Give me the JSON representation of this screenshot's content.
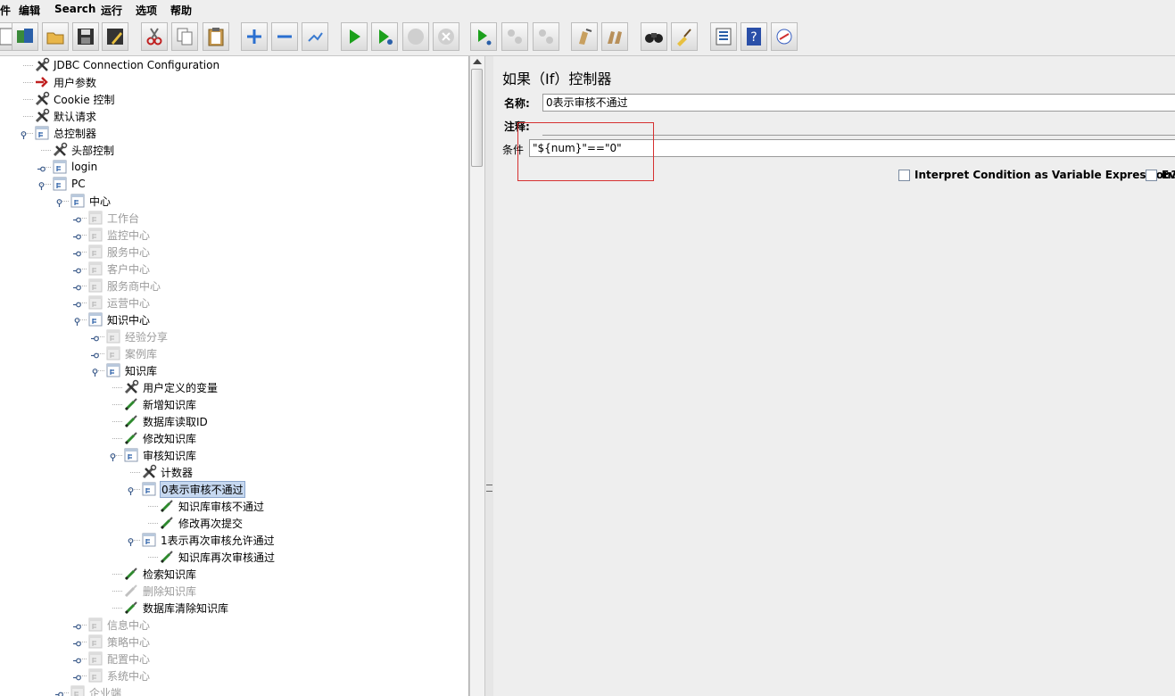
{
  "menu": [
    {
      "id": "file",
      "label": "件"
    },
    {
      "id": "edit",
      "label": "编辑"
    },
    {
      "id": "search",
      "label": "Search"
    },
    {
      "id": "run",
      "label": "运行"
    },
    {
      "id": "options",
      "label": "选项"
    },
    {
      "id": "help",
      "label": "帮助"
    }
  ],
  "toolbar": [
    "new-icon",
    "templates-icon",
    "open-icon",
    "save-icon",
    "save-as-icon",
    "cut-icon",
    "copy-icon",
    "paste-icon",
    "expand-icon",
    "collapse-icon",
    "toggle-icon",
    "start-icon",
    "start-no-pauses-icon",
    "stop-icon",
    "shutdown-icon",
    "remote-start-icon",
    "remote-stop-icon",
    "remote-shutdown-icon",
    "clear-icon",
    "clear-all-icon",
    "search-icon",
    "reset-search-icon",
    "function-helper-icon",
    "help-icon",
    "log-viewer-icon"
  ],
  "tree": [
    {
      "label": "JDBC Connection Configuration",
      "icon": "config",
      "depth": 1
    },
    {
      "label": "用户参数",
      "icon": "preprocessor",
      "depth": 1
    },
    {
      "label": "Cookie 控制",
      "icon": "config",
      "depth": 1
    },
    {
      "label": "默认请求",
      "icon": "config",
      "depth": 1
    },
    {
      "label": "总控制器",
      "icon": "controller",
      "depth": 1,
      "toggle": "open"
    },
    {
      "label": "头部控制",
      "icon": "config",
      "depth": 2
    },
    {
      "label": "login",
      "icon": "controller",
      "depth": 2,
      "toggle": "closed"
    },
    {
      "label": "PC",
      "icon": "controller",
      "depth": 2,
      "toggle": "open"
    },
    {
      "label": "中心",
      "icon": "controller",
      "depth": 3,
      "toggle": "open"
    },
    {
      "label": "工作台",
      "icon": "controller",
      "depth": 4,
      "toggle": "closed",
      "disabled": true
    },
    {
      "label": "监控中心",
      "icon": "controller",
      "depth": 4,
      "toggle": "closed",
      "disabled": true
    },
    {
      "label": "服务中心",
      "icon": "controller",
      "depth": 4,
      "toggle": "closed",
      "disabled": true
    },
    {
      "label": "客户中心",
      "icon": "controller",
      "depth": 4,
      "toggle": "closed",
      "disabled": true
    },
    {
      "label": "服务商中心",
      "icon": "controller",
      "depth": 4,
      "toggle": "closed",
      "disabled": true
    },
    {
      "label": "运营中心",
      "icon": "controller",
      "depth": 4,
      "toggle": "closed",
      "disabled": true
    },
    {
      "label": "知识中心",
      "icon": "controller",
      "depth": 4,
      "toggle": "open"
    },
    {
      "label": "经验分享",
      "icon": "controller",
      "depth": 5,
      "toggle": "closed",
      "disabled": true
    },
    {
      "label": "案例库",
      "icon": "controller",
      "depth": 5,
      "toggle": "closed",
      "disabled": true
    },
    {
      "label": "知识库",
      "icon": "controller",
      "depth": 5,
      "toggle": "open"
    },
    {
      "label": "用户定义的变量",
      "icon": "config",
      "depth": 6
    },
    {
      "label": "新增知识库",
      "icon": "sampler",
      "depth": 6
    },
    {
      "label": "数据库读取ID",
      "icon": "sampler",
      "depth": 6
    },
    {
      "label": "修改知识库",
      "icon": "sampler",
      "depth": 6
    },
    {
      "label": "审核知识库",
      "icon": "controller",
      "depth": 6,
      "toggle": "open"
    },
    {
      "label": "计数器",
      "icon": "config",
      "depth": 7
    },
    {
      "label": "0表示审核不通过",
      "icon": "controller",
      "depth": 7,
      "toggle": "open",
      "selected": true
    },
    {
      "label": "知识库审核不通过",
      "icon": "sampler",
      "depth": 8
    },
    {
      "label": "修改再次提交",
      "icon": "sampler",
      "depth": 8
    },
    {
      "label": "1表示再次审核允许通过",
      "icon": "controller",
      "depth": 7,
      "toggle": "open"
    },
    {
      "label": "知识库再次审核通过",
      "icon": "sampler",
      "depth": 8
    },
    {
      "label": "检索知识库",
      "icon": "sampler",
      "depth": 6
    },
    {
      "label": "删除知识库",
      "icon": "sampler",
      "depth": 6,
      "disabled": true
    },
    {
      "label": "数据库清除知识库",
      "icon": "sampler",
      "depth": 6
    },
    {
      "label": "信息中心",
      "icon": "controller",
      "depth": 4,
      "toggle": "closed",
      "disabled": true
    },
    {
      "label": "策略中心",
      "icon": "controller",
      "depth": 4,
      "toggle": "closed",
      "disabled": true
    },
    {
      "label": "配置中心",
      "icon": "controller",
      "depth": 4,
      "toggle": "closed",
      "disabled": true
    },
    {
      "label": "系统中心",
      "icon": "controller",
      "depth": 4,
      "toggle": "closed",
      "disabled": true
    },
    {
      "label": "企业端",
      "icon": "controller",
      "depth": 3,
      "toggle": "closed",
      "disabled": true
    }
  ],
  "panel": {
    "title": "如果（If）控制器",
    "name_label": "名称:",
    "name_value": "0表示审核不通过",
    "comment_label": "注释:",
    "condition_label": "条件",
    "condition_value": "\"${num}\"==\"0\"",
    "interpret_label": "Interpret Condition as Variable Expression?",
    "interpret_checked": false,
    "evaluate_label": "Eva",
    "evaluate_checked": false
  },
  "colors": {
    "highlight_box": "#d63030",
    "selection": "#c6d8f0",
    "disabled_text": "#9a9a9a"
  }
}
